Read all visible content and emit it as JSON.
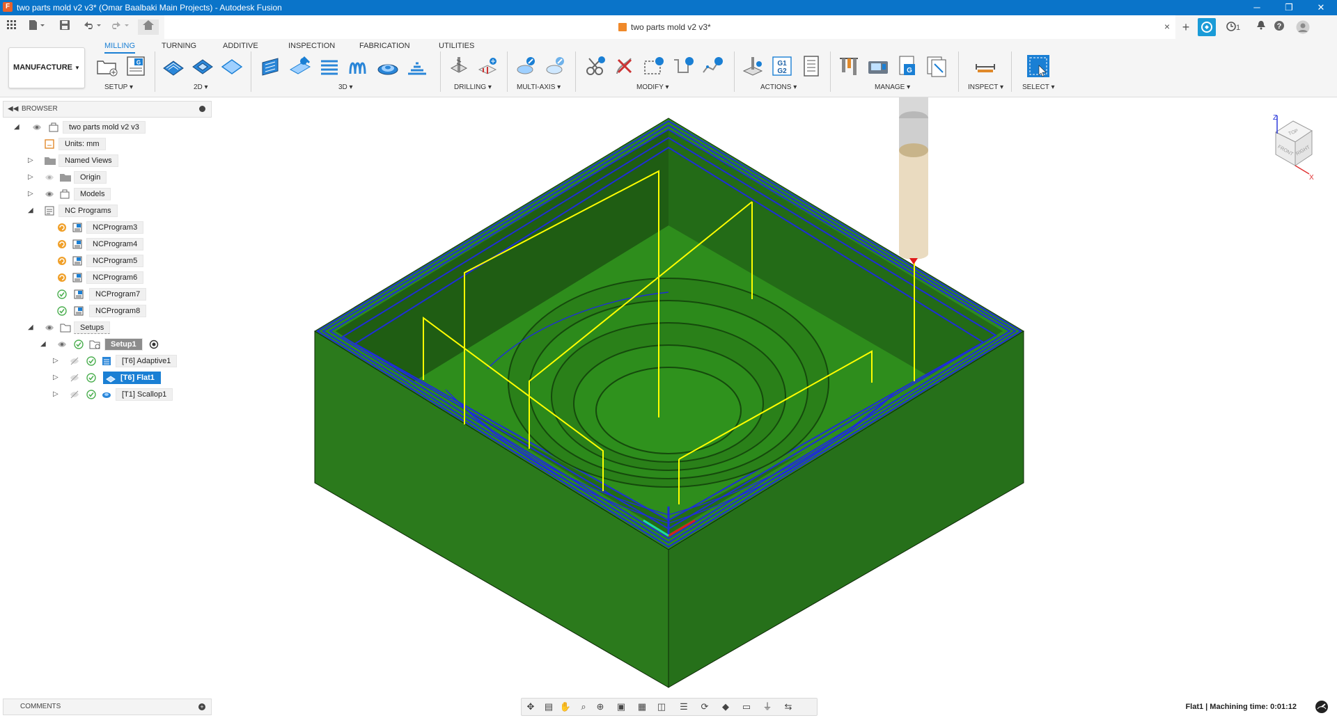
{
  "window": {
    "title": "two parts mold v2 v3* (Omar Baalbaki Main Projects) - Autodesk Fusion",
    "app_icon": "F",
    "controls": [
      "─",
      "❐",
      "✕"
    ]
  },
  "document_tab": {
    "title": "two parts mold v2 v3*",
    "close": "×"
  },
  "right_toolbar": {
    "job_count": "1"
  },
  "ribbon": {
    "workspace": "MANUFACTURE",
    "tabs": [
      "MILLING",
      "TURNING",
      "ADDITIVE",
      "INSPECTION",
      "FABRICATION",
      "UTILITIES"
    ],
    "groups": [
      "SETUP ▾",
      "2D ▾",
      "3D ▾",
      "DRILLING ▾",
      "MULTI-AXIS ▾",
      "MODIFY ▾",
      "ACTIONS ▾",
      "MANAGE ▾",
      "INSPECT ▾",
      "SELECT ▾"
    ]
  },
  "browser": {
    "title": "BROWSER",
    "root": "two parts mold v2 v3",
    "units": "Units: mm",
    "named_views": "Named Views",
    "origin": "Origin",
    "models": "Models",
    "nc_programs": "NC Programs",
    "programs": [
      "NCProgram3",
      "NCProgram4",
      "NCProgram5",
      "NCProgram6",
      "NCProgram7",
      "NCProgram8"
    ],
    "setups": "Setups",
    "setup1": "Setup1",
    "ops": [
      "[T6] Adaptive1",
      "[T6] Flat1",
      "[T1] Scallop1"
    ]
  },
  "comments": {
    "title": "COMMENTS"
  },
  "status_bar": {
    "text": "Flat1 | Machining time: 0:01:12"
  },
  "viewcube": {
    "top": "TOP",
    "front": "FRONT",
    "right": "RIGHT",
    "z": "Z",
    "x": "X"
  },
  "colors": {
    "titlebar": "#0a74c9",
    "accent": "#1a7fd4",
    "stock_green": "#2e7d1e",
    "toolpath_yellow": "#ffff00",
    "toolpath_blue": "#1e2dd8"
  },
  "icons": {
    "undo": "undo-icon",
    "redo": "redo-icon",
    "save": "save-icon",
    "home": "home-icon",
    "grid": "app-grid-icon",
    "file": "file-icon"
  }
}
